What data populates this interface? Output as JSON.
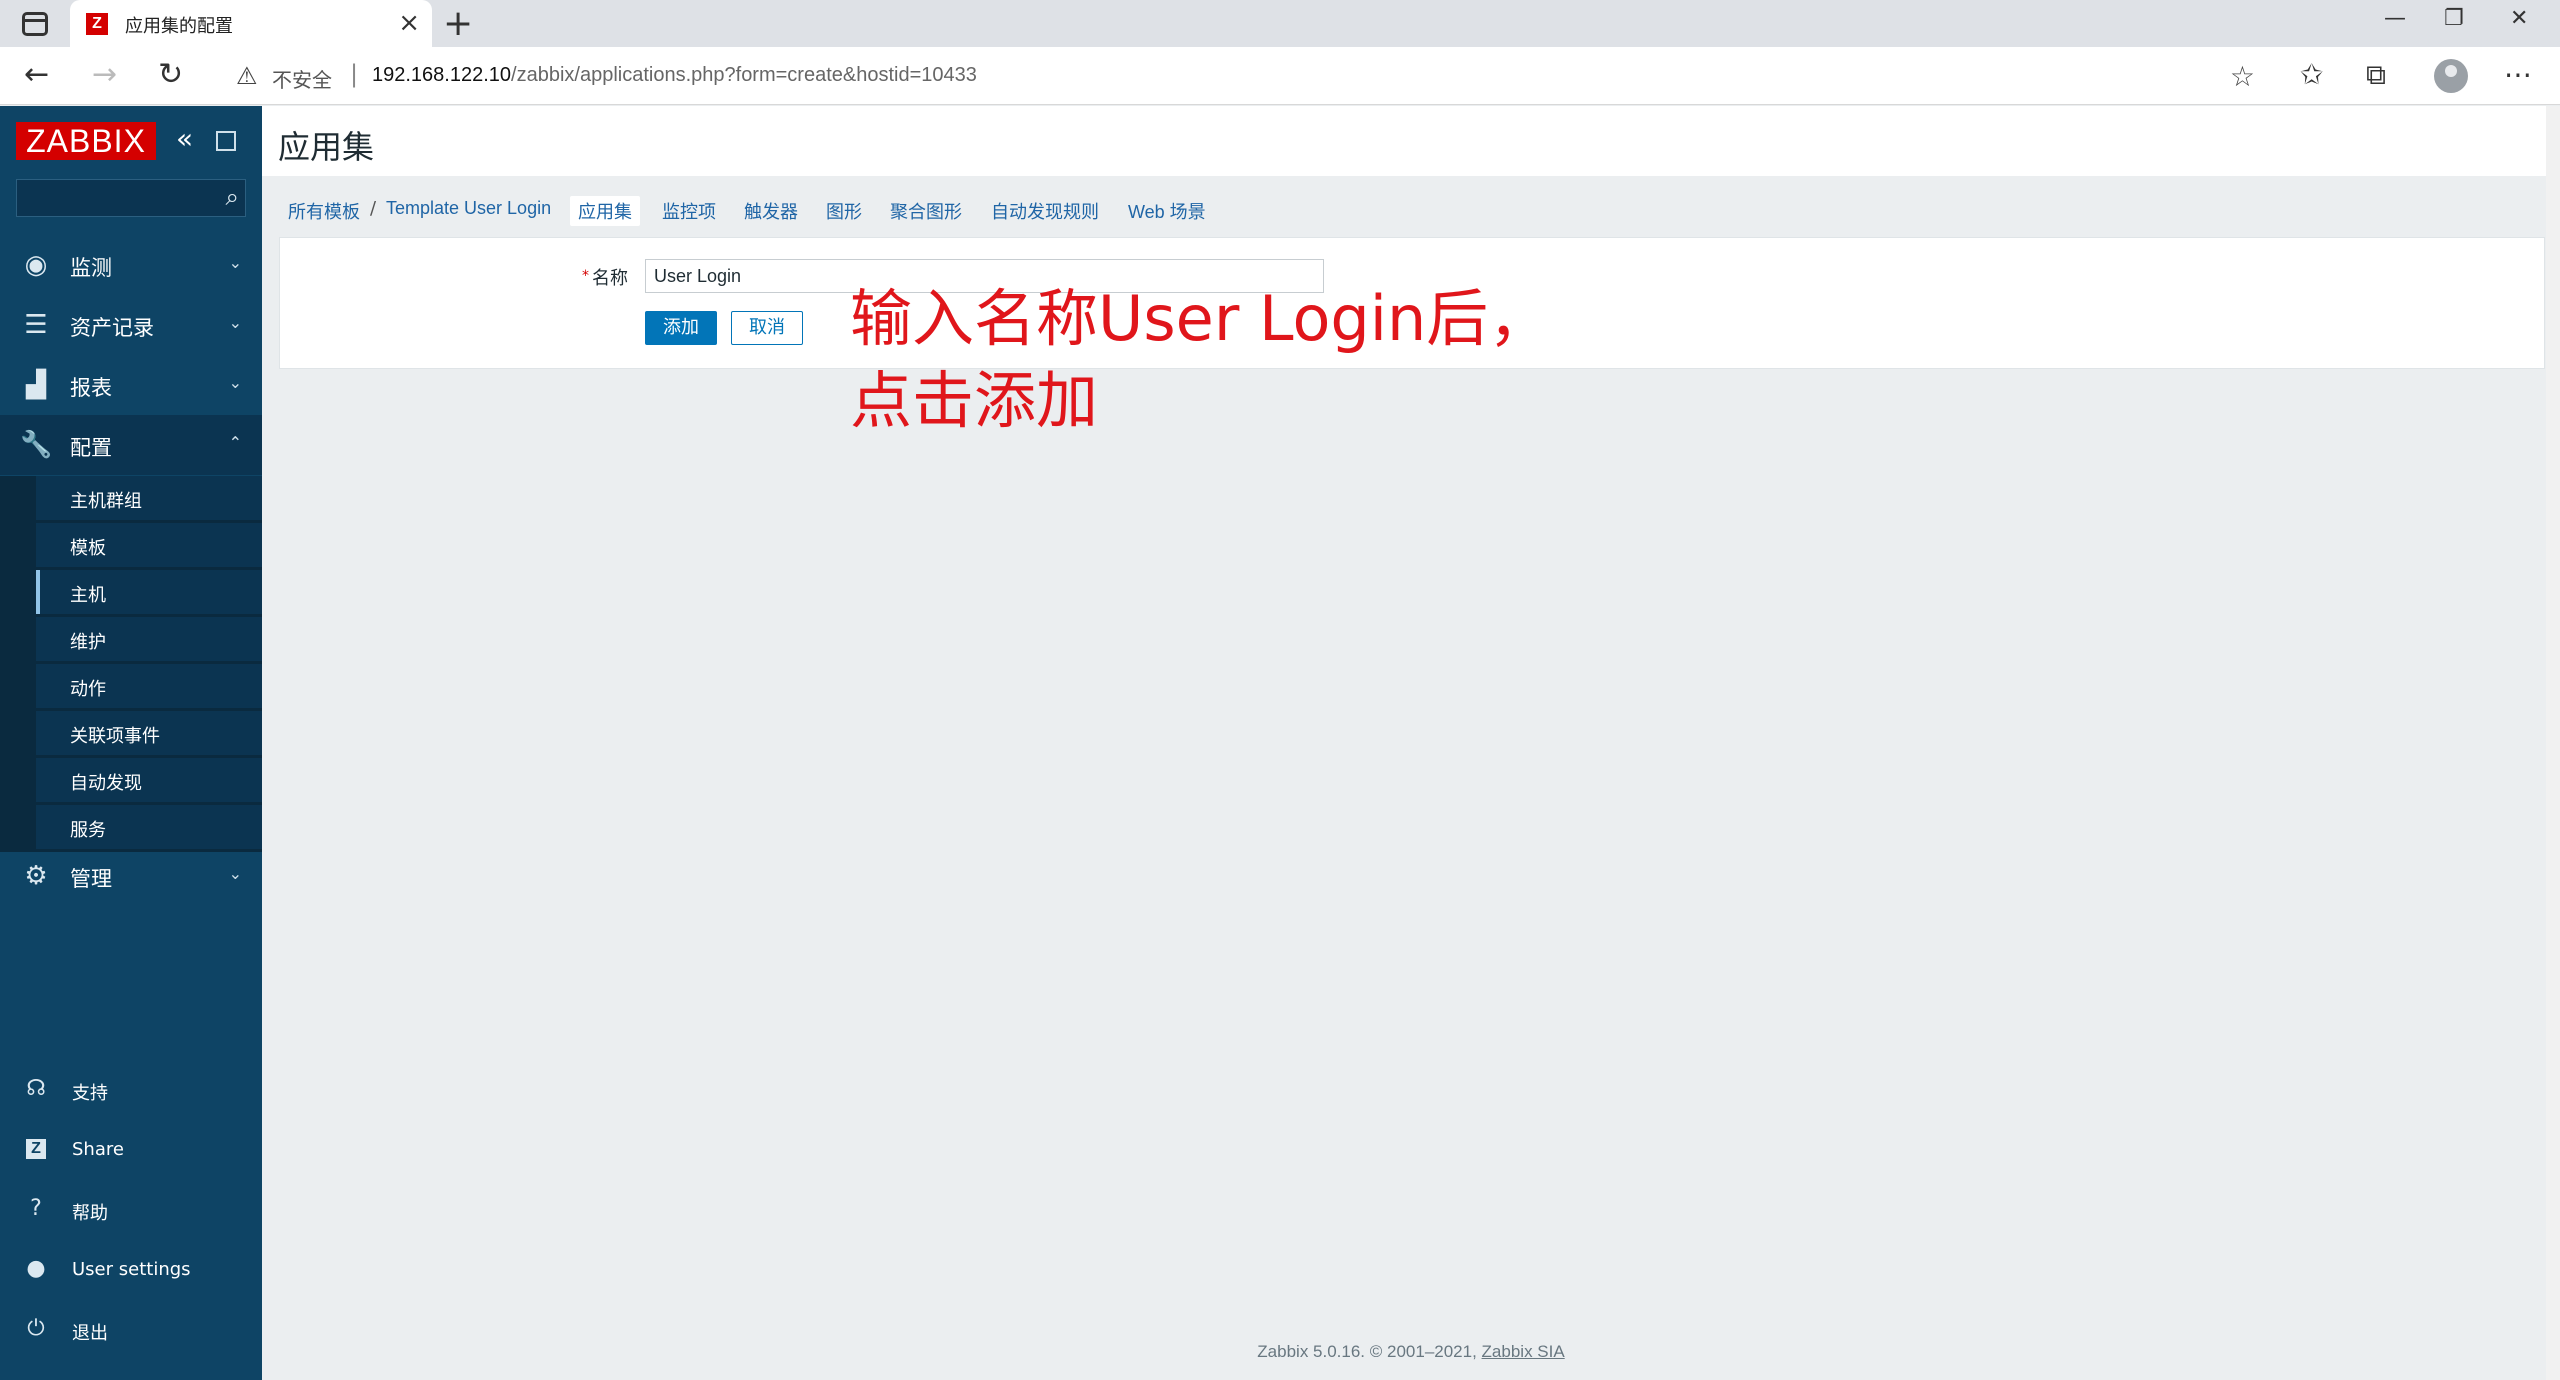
{
  "browser": {
    "tab_title": "应用集的配置",
    "tab_favicon": "Z",
    "insecure_label": "不安全",
    "url_host": "192.168.122.10",
    "url_path": "/zabbix/applications.php?form=create&hostid=10433"
  },
  "sidebar": {
    "logo": "ZABBIX",
    "search_placeholder": "",
    "menu": [
      {
        "label": "监测",
        "icon": "eye-icon"
      },
      {
        "label": "资产记录",
        "icon": "list-icon"
      },
      {
        "label": "报表",
        "icon": "bar-chart-icon"
      },
      {
        "label": "配置",
        "icon": "wrench-icon"
      },
      {
        "label": "管理",
        "icon": "gear-icon"
      }
    ],
    "config_submenu": [
      "主机群组",
      "模板",
      "主机",
      "维护",
      "动作",
      "关联项事件",
      "自动发现",
      "服务"
    ],
    "bottom": [
      {
        "label": "支持",
        "icon": "headset-icon"
      },
      {
        "label": "Share",
        "icon": "zabbix-share-icon"
      },
      {
        "label": "帮助",
        "icon": "help-icon"
      },
      {
        "label": "User settings",
        "icon": "user-icon"
      },
      {
        "label": "退出",
        "icon": "power-icon"
      }
    ]
  },
  "page": {
    "title": "应用集"
  },
  "breadcrumb": {
    "all_templates": "所有模板",
    "separator": "/",
    "template": "Template User Login",
    "tabs": [
      "应用集",
      "监控项",
      "触发器",
      "图形",
      "聚合图形",
      "自动发现规则",
      "Web 场景"
    ]
  },
  "form": {
    "required_mark": "*",
    "name_label": "名称",
    "name_value": "User Login",
    "add_button": "添加",
    "cancel_button": "取消"
  },
  "annotation": {
    "line1": "输入名称User Login后，",
    "line2": "点击添加"
  },
  "footer": {
    "text": "Zabbix 5.0.16. © 2001–2021, ",
    "link": "Zabbix SIA"
  }
}
